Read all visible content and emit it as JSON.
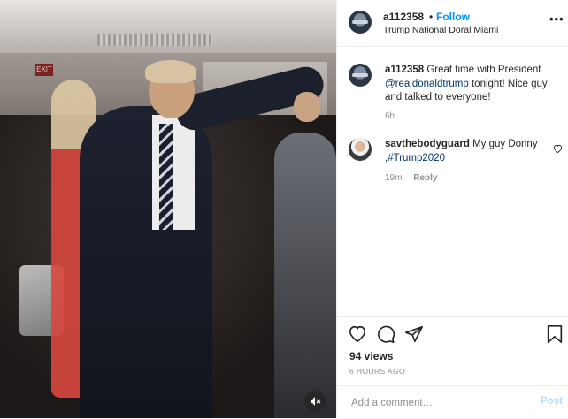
{
  "post": {
    "username": "a112358",
    "follow_label": "Follow",
    "dot": "•",
    "location": "Trump National Doral Miami",
    "more_label": "•••"
  },
  "media": {
    "exit_sign": "EXIT",
    "mute_icon": "speaker-muted-icon"
  },
  "comments": [
    {
      "username": "a112358",
      "text_before": "Great time with President ",
      "mention": "@realdonaldtrump",
      "text_after": " tonight! Nice guy and talked to everyone!",
      "time": "6h"
    },
    {
      "username": "savthebodyguard",
      "text_before": "My guy Donny ,",
      "mention": "#Trump2020",
      "text_after": "",
      "time": "19m",
      "reply_label": "Reply"
    }
  ],
  "actions": {
    "icons": [
      "heart-icon",
      "comment-icon",
      "share-icon",
      "bookmark-icon"
    ],
    "views": "94 views",
    "posted_ago": "6 HOURS AGO"
  },
  "add_comment": {
    "placeholder": "Add a comment…",
    "post_label": "Post"
  },
  "colors": {
    "follow": "#0095f6",
    "post_disabled": "#b2dffc",
    "mention": "#00376b",
    "muted_text": "#8e8e8e"
  }
}
